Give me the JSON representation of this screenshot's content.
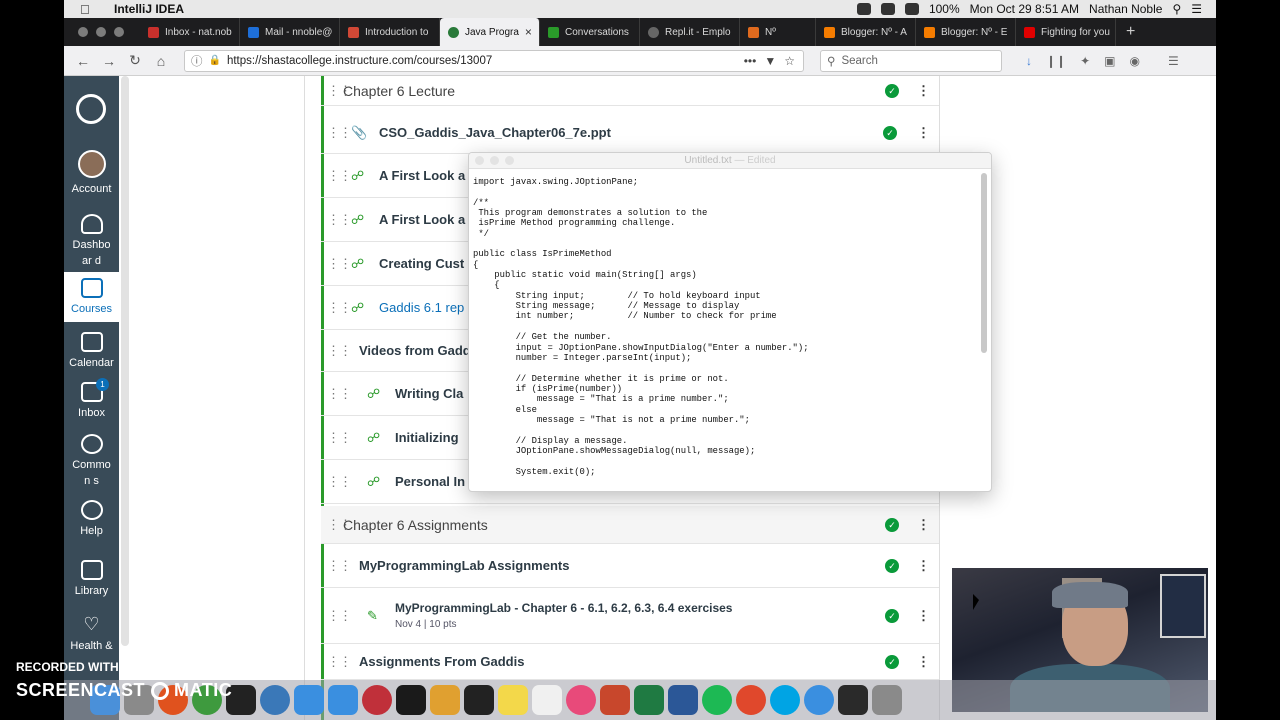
{
  "menubar": {
    "app": "IntelliJ IDEA",
    "battery": "100%",
    "clock": "Mon Oct 29  8:51 AM",
    "user": "Nathan Noble"
  },
  "tabs": [
    {
      "label": "Inbox - nat.nob",
      "color": "#c9302c"
    },
    {
      "label": "Mail - nnoble@",
      "color": "#1e6fd9"
    },
    {
      "label": "Introduction to",
      "color": "#d14836"
    },
    {
      "label": "Java Progra",
      "color": "#2a7a3a",
      "active": true
    },
    {
      "label": "Conversations",
      "color": "#2a9a2a"
    },
    {
      "label": "Repl.it - Emplo",
      "color": "#666666"
    },
    {
      "label": "Nº",
      "color": "#e06a1e"
    },
    {
      "label": "Blogger: Nº - A",
      "color": "#f57c00"
    },
    {
      "label": "Blogger: Nº - E",
      "color": "#f57c00"
    },
    {
      "label": "Fighting for you",
      "color": "#e00000"
    }
  ],
  "nav": {
    "url": "https://shastacollege.instructure.com/courses/13007",
    "search_placeholder": "Search"
  },
  "sidenav": {
    "account": "Account",
    "dashboard": "Dashboar d",
    "courses": "Courses",
    "calendar": "Calendar",
    "inbox": "Inbox",
    "inbox_badge": "1",
    "commons": "Common s",
    "help": "Help",
    "library": "Library",
    "health": "Health &"
  },
  "modules": {
    "chapter6_lecture": "Chapter 6 Lecture",
    "ppt": "CSO_Gaddis_Java_Chapter06_7e.ppt",
    "first_look_1": "A First Look a",
    "first_look_2": "A First Look a",
    "creating_cust": "Creating Cust",
    "gaddis_61": "Gaddis 6.1 rep",
    "videos": "Videos from Gadd",
    "writing": "Writing Cla",
    "initializing": "Initializing",
    "personal": "Personal In",
    "chapter6_assign": "Chapter 6 Assignments",
    "mpl_assign": "MyProgrammingLab Assignments",
    "mpl_ch6": "MyProgrammingLab - Chapter 6 - 6.1, 6.2, 6.3, 6.4 exercises",
    "mpl_meta": "Nov 4  |  10 pts",
    "assign_gaddis": "Assignments From Gaddis"
  },
  "textedit": {
    "title": "Untitled.txt",
    "status": "— Edited",
    "code": "import javax.swing.JOptionPane;\n\n/**\n This program demonstrates a solution to the\n isPrime Method programming challenge.\n */\n\npublic class IsPrimeMethod\n{\n    public static void main(String[] args)\n    {\n        String input;        // To hold keyboard input\n        String message;      // Message to display\n        int number;          // Number to check for prime\n\n        // Get the number.\n        input = JOptionPane.showInputDialog(\"Enter a number.\");\n        number = Integer.parseInt(input);\n\n        // Determine whether it is prime or not.\n        if (isPrime(number))\n            message = \"That is a prime number.\";\n        else\n            message = \"That is not a prime number.\";\n\n        // Display a message.\n        JOptionPane.showMessageDialog(null, message);\n\n        System.exit(0);"
  },
  "watermark": {
    "line1": "RECORDED WITH",
    "line2": "SCREENCAST",
    "line3": "MATIC"
  }
}
